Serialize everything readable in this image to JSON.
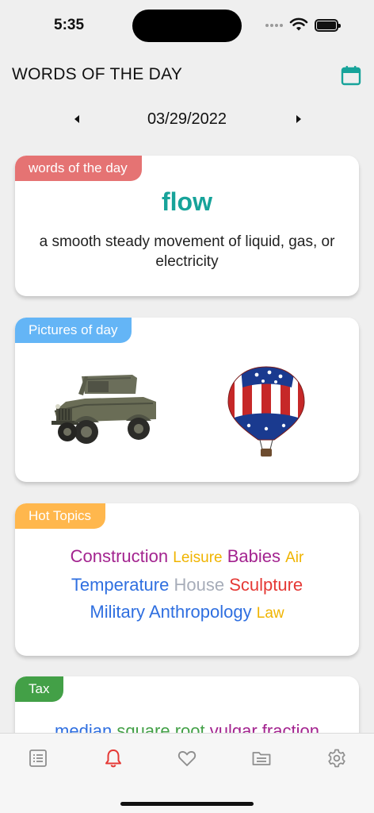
{
  "status": {
    "time": "5:35"
  },
  "header": {
    "title": "WORDS OF THE DAY",
    "calendar_icon": "calendar-icon"
  },
  "date_nav": {
    "date": "03/29/2022",
    "prev_icon": "caret-left-icon",
    "next_icon": "caret-right-icon"
  },
  "words_card": {
    "tag": "words of the day",
    "tag_color": "#e57373",
    "word": "flow",
    "word_color": "#17a39a",
    "definition": "a smooth steady movement of liquid, gas, or electricity"
  },
  "pictures_card": {
    "tag": "Pictures of day",
    "tag_color": "#64b5f6",
    "pictures": [
      {
        "name": "jeep"
      },
      {
        "name": "hot-air-balloon"
      }
    ]
  },
  "topics_card": {
    "tag": "Hot Topics",
    "tag_color": "#ffb74d",
    "topics": [
      {
        "label": "Construction",
        "color": "#a3238f"
      },
      {
        "label": "Leisure",
        "color": "#f0b400"
      },
      {
        "label": "Babies",
        "color": "#a3238f"
      },
      {
        "label": "Air",
        "color": "#f0b400"
      },
      {
        "label": "Temperature",
        "color": "#2f6fe0"
      },
      {
        "label": "House",
        "color": "#a7adb9"
      },
      {
        "label": "Sculpture",
        "color": "#e53935"
      },
      {
        "label": "Military",
        "color": "#2f6fe0"
      },
      {
        "label": "Anthropology",
        "color": "#2f6fe0"
      },
      {
        "label": "Law",
        "color": "#f0b400"
      }
    ]
  },
  "tax_card": {
    "tag": "Tax",
    "tag_color": "#43a047",
    "terms": [
      {
        "label": "median",
        "color": "#2f6fe0"
      },
      {
        "label": "square root",
        "color": "#43a047"
      },
      {
        "label": "vulgar fraction",
        "color": "#a3238f"
      }
    ]
  },
  "tab_bar": {
    "active_color": "#e53935",
    "inactive_color": "#8e8e8e",
    "tabs": [
      {
        "icon": "list-icon",
        "active": false
      },
      {
        "icon": "bell-icon",
        "active": true
      },
      {
        "icon": "heart-icon",
        "active": false
      },
      {
        "icon": "folder-icon",
        "active": false
      },
      {
        "icon": "gear-icon",
        "active": false
      }
    ]
  }
}
